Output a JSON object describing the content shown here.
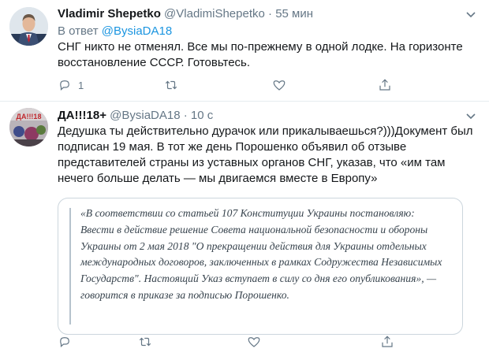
{
  "tweets": [
    {
      "name": "Vladimir Shepetko",
      "handle": "@VladimiShepetko",
      "separator": "·",
      "time": "55 мин",
      "reply_prefix": "В ответ",
      "reply_to": "@BysiaDA18",
      "text": "СНГ никто не отменял. Все мы по-прежнему в одной лодке. На горизонте восстановление СССР. Готовьтесь.",
      "reply_count": "1"
    },
    {
      "name": "ДА!!!18+",
      "handle": "@BysiaDA18",
      "separator": "·",
      "time": "10 с",
      "text": "Дедушка ты действительно дурачок или прикалываешься?)))Документ был подписан 19 мая. В тот же день Порошенко объявил об отзыве представителей страны из уставных органов СНГ, указав, что «им там нечего больше делать — мы двигаемся вместе в Европу»",
      "quote": "«В соответствии со статьей 107 Конституции Украины постановляю: Ввести в действие решение Совета национальной безопасности и обороны Украины от 2 мая 2018 \"О прекращении действия для Украины отдельных международных договоров, заключенных в рамках Содружества Независимых Государств\". Настоящий Указ вступает в силу со дня его опубликования», — говорится в приказе за подписью Порошенко."
    }
  ],
  "icons": {
    "reply": "reply-icon",
    "retweet": "retweet-icon",
    "like": "heart-icon",
    "share": "share-icon",
    "more": "chevron-down-icon"
  }
}
